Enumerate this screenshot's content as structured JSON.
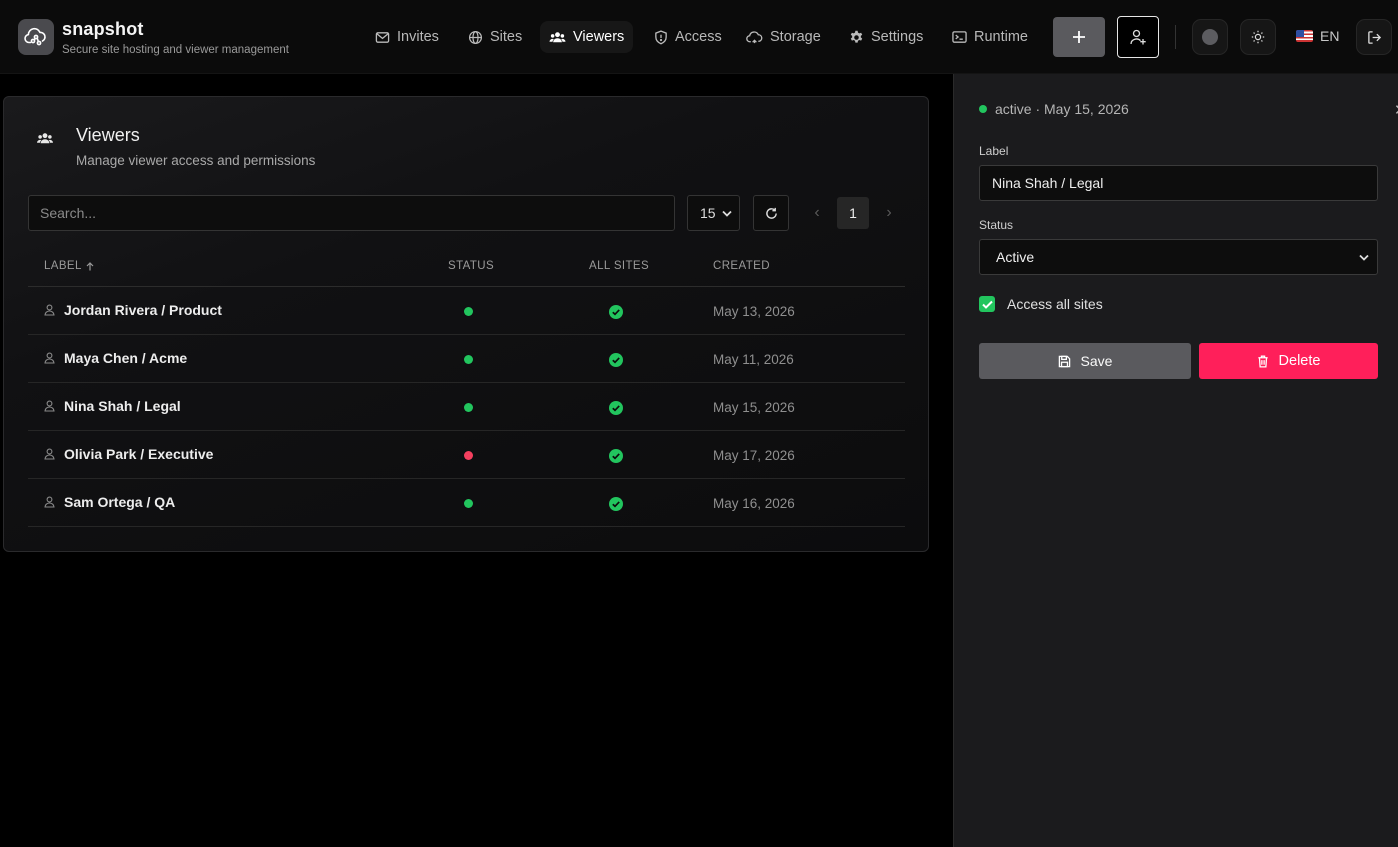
{
  "app": {
    "name": "snapshot",
    "tagline": "Secure site hosting and viewer management"
  },
  "nav": [
    {
      "label": "Invites",
      "icon": "mail-icon",
      "active": false
    },
    {
      "label": "Sites",
      "icon": "globe-icon",
      "active": false
    },
    {
      "label": "Viewers",
      "icon": "users-icon",
      "active": true
    },
    {
      "label": "Access",
      "icon": "shield-icon",
      "active": false
    },
    {
      "label": "Storage",
      "icon": "cloud-icon",
      "active": false
    },
    {
      "label": "Settings",
      "icon": "gear-icon",
      "active": false
    },
    {
      "label": "Runtime",
      "icon": "terminal-icon",
      "active": false
    }
  ],
  "header_actions": {
    "language": "EN",
    "icons": [
      "plus-icon",
      "user-plus-icon",
      "theme-dot-icon",
      "sun-icon",
      "us-flag-icon",
      "logout-icon"
    ]
  },
  "viewers": {
    "title": "Viewers",
    "subtitle": "Manage viewer access and permissions",
    "search_placeholder": "Search...",
    "page_size": "15",
    "current_page": "1",
    "prev_glyph": "‹",
    "next_glyph": "›",
    "columns": {
      "label": "LABEL",
      "status": "STATUS",
      "all_sites": "ALL SITES",
      "created": "CREATED"
    },
    "rows": [
      {
        "label": "Jordan Rivera / Product",
        "status": "active",
        "all_sites": true,
        "created": "May 13, 2026"
      },
      {
        "label": "Maya Chen / Acme",
        "status": "active",
        "all_sites": true,
        "created": "May 11, 2026"
      },
      {
        "label": "Nina Shah / Legal",
        "status": "active",
        "all_sites": true,
        "created": "May 15, 2026"
      },
      {
        "label": "Olivia Park / Executive",
        "status": "inactive",
        "all_sites": true,
        "created": "May 17, 2026"
      },
      {
        "label": "Sam Ortega / QA",
        "status": "active",
        "all_sites": true,
        "created": "May 16, 2026"
      }
    ]
  },
  "detail": {
    "status_line": "active · May 15, 2026",
    "close_glyph": "✕",
    "label_field_label": "Label",
    "label_value": "Nina Shah / Legal",
    "status_field_label": "Status",
    "status_value": "Active",
    "access_all_sites_label": "Access all sites",
    "access_all_sites_checked": true,
    "save_label": "Save",
    "delete_label": "Delete"
  },
  "colors": {
    "active": "#22c55e",
    "inactive": "#f43f5e",
    "delete": "#ff1f5a",
    "save": "#5a5a5e"
  }
}
